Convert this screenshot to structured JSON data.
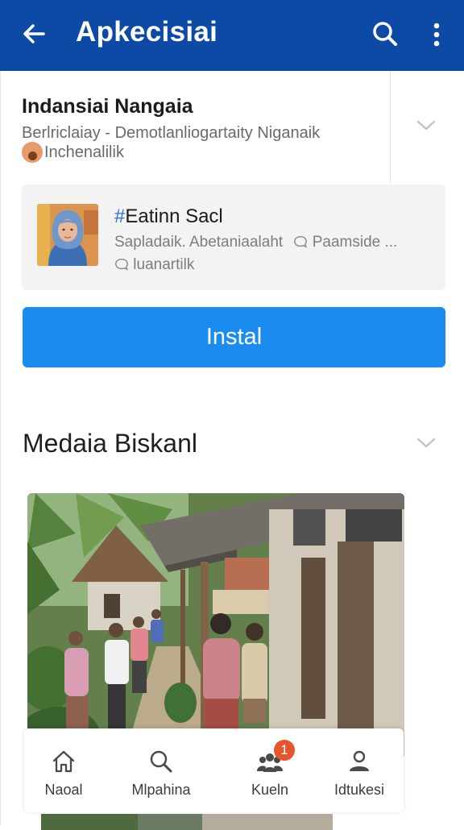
{
  "appbar": {
    "title": "Apkecisiai"
  },
  "app": {
    "name": "Indansiai Nangaia",
    "subtitle": "Berlriclaiay - Demotlanliogartaity Niganaik",
    "developer": "Inchenalilik"
  },
  "post": {
    "hash": "#",
    "title": "Eatinn Sacl",
    "meta": "Sapladaik. Abetaniaalaht",
    "meta_extra": "Paamside ...",
    "meta2": "luanartilk"
  },
  "install_label": "Instal",
  "section": {
    "title": "Medaia Biskanl"
  },
  "bottom_nav": [
    {
      "label": "Naoal",
      "icon": "home-icon"
    },
    {
      "label": "Mlpahina",
      "icon": "search-icon"
    },
    {
      "label": "Kueln",
      "icon": "people-icon",
      "badge": "1"
    },
    {
      "label": "Idtukesi",
      "icon": "account-icon"
    }
  ],
  "colors": {
    "appbar": "#0c4aa6",
    "install": "#1a8cf0",
    "badge": "#e5562e",
    "hashtag": "#2a73d4"
  }
}
